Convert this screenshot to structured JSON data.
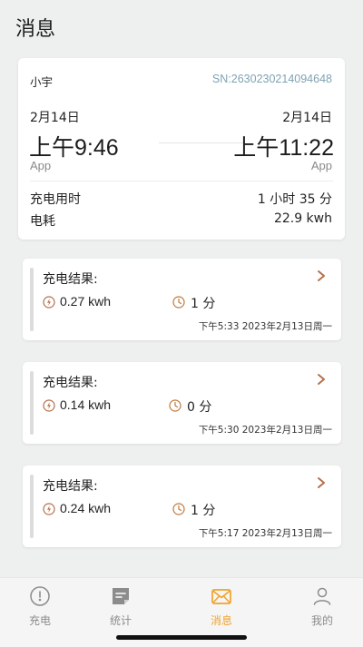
{
  "page": {
    "title": "消息"
  },
  "session": {
    "user": "小宇",
    "sn": "SN:2630230214094648",
    "start": {
      "date": "2月14日",
      "time": "上午9:46",
      "source": "App"
    },
    "end": {
      "date": "2月14日",
      "time": "上午11:22",
      "source": "App"
    },
    "duration_label": "充电用时",
    "duration_value": "1 小时 35 分",
    "energy_label": "电耗",
    "energy_value": "22.9 kwh"
  },
  "messages": [
    {
      "title": "充电结果:",
      "energy": "0.27 kwh",
      "duration": "1 分",
      "stamp": "下午5:33 2023年2月13日周一"
    },
    {
      "title": "充电结果:",
      "energy": "0.14 kwh",
      "duration": "0 分",
      "stamp": "下午5:30 2023年2月13日周一"
    },
    {
      "title": "充电结果:",
      "energy": "0.24 kwh",
      "duration": "1 分",
      "stamp": "下午5:17 2023年2月13日周一"
    }
  ],
  "nav": {
    "charge": "充电",
    "stats": "统计",
    "messages": "消息",
    "mine": "我的"
  },
  "colors": {
    "accent": "#f0a32b",
    "sn": "#7fa3b4",
    "chevron": "#b5704a"
  },
  "icons": [
    "bolt-icon",
    "clock-icon",
    "chevron-right-icon",
    "gauge-icon",
    "note-icon",
    "mail-icon",
    "person-icon"
  ]
}
